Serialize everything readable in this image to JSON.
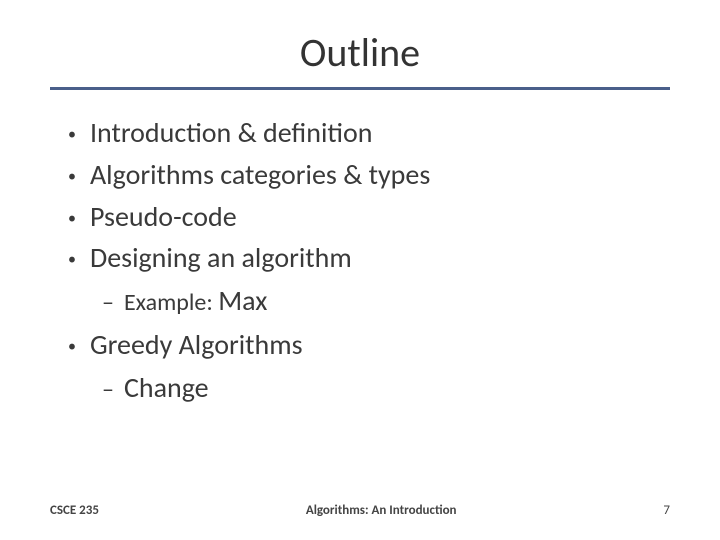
{
  "title": "Outline",
  "bullets": [
    {
      "text": "Introduction & definition"
    },
    {
      "text": "Algorithms categories & types"
    },
    {
      "text": "Pseudo-code"
    },
    {
      "text": "Designing an algorithm"
    }
  ],
  "sub_after_4": {
    "label": "Example:",
    "value": "Max"
  },
  "bullet5": {
    "text": "Greedy Algorithms"
  },
  "sub_after_5": {
    "text": "Change"
  },
  "footer": {
    "left": "CSCE 235",
    "center": "Algorithms: An Introduction",
    "right": "7"
  }
}
